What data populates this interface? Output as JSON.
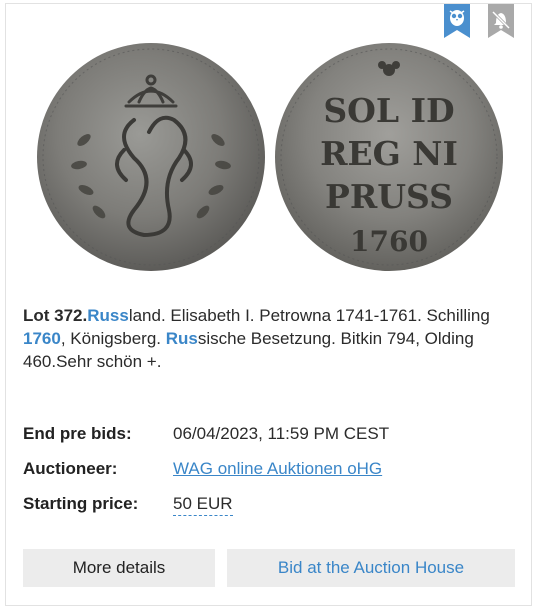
{
  "lot": {
    "number_label": "Lot 372.",
    "title_segments": [
      {
        "text": "Russ",
        "highlight": true
      },
      {
        "text": "land. Elisabeth I. Petrowna 1741-1761. Schilling ",
        "highlight": false
      },
      {
        "text": "1760",
        "highlight": true
      },
      {
        "text": ", Königsberg. ",
        "highlight": false
      },
      {
        "text": "Rus",
        "highlight": true
      },
      {
        "text": "sische Besetzung. Bitkin 794, Olding 460.Sehr schön +.",
        "highlight": false
      }
    ]
  },
  "details": {
    "end_pre_bids_label": "End pre bids:",
    "end_pre_bids_value": "06/04/2023, 11:59 PM CEST",
    "auctioneer_label": "Auctioneer:",
    "auctioneer_value": "WAG online Auktionen oHG",
    "starting_price_label": "Starting price:",
    "starting_price_value": "50 EUR"
  },
  "buttons": {
    "more_details": "More details",
    "bid": "Bid at the Auction House"
  },
  "icons": {
    "watch_bookmark": "owl-bookmark-icon",
    "notify_bookmark": "bell-off-bookmark-icon"
  },
  "colors": {
    "accent": "#3a86c8",
    "bookmark_active": "#4a8fce",
    "bookmark_inactive": "#a9a9a9",
    "button_bg": "#ececec"
  },
  "coin_reverse_legend": [
    "SOL ID",
    "REG NI",
    "PRUSS",
    "1760"
  ]
}
